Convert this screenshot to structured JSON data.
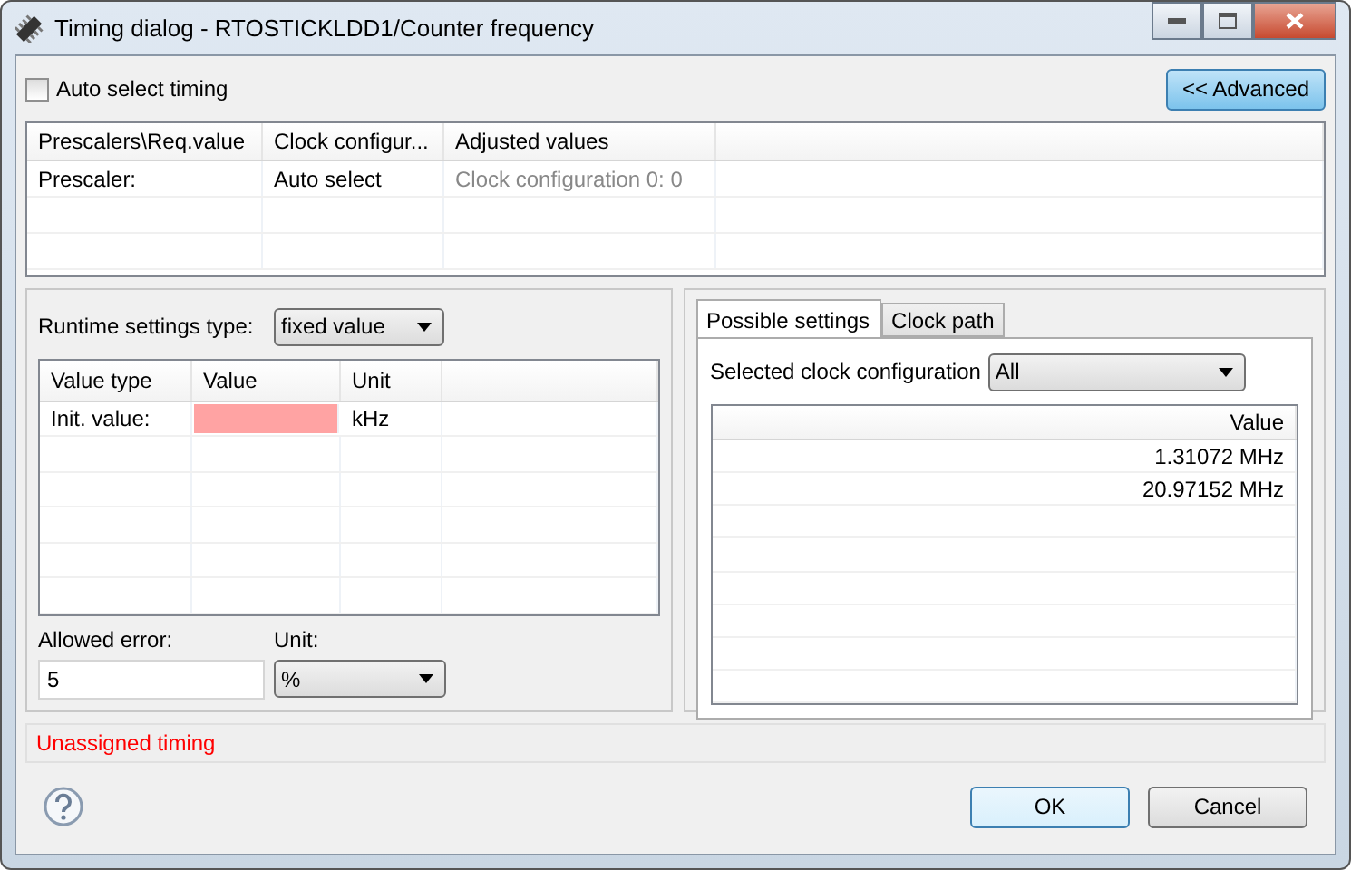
{
  "window": {
    "title": "Timing dialog - RTOSTICKLDD1/Counter frequency"
  },
  "auto_select": {
    "label": "Auto select timing",
    "checked": false
  },
  "advanced_button": {
    "label": "<< Advanced"
  },
  "prescaler_table": {
    "columns": [
      "Prescalers\\Req.value",
      "Clock configur...",
      "Adjusted values"
    ],
    "rows": [
      [
        "Prescaler:",
        "Auto select",
        "Clock configuration 0: 0"
      ]
    ]
  },
  "runtime": {
    "label": "Runtime settings type:",
    "value": "fixed value"
  },
  "value_table": {
    "columns": [
      "Value type",
      "Value",
      "Unit"
    ],
    "rows": [
      {
        "type": "Init. value:",
        "value": "",
        "invalid": true,
        "unit": "kHz"
      }
    ]
  },
  "allowed_error": {
    "label": "Allowed error:",
    "value": "5"
  },
  "unit": {
    "label": "Unit:",
    "value": "%"
  },
  "tabs": [
    {
      "label": "Possible settings",
      "selected": true
    },
    {
      "label": "Clock path",
      "selected": false
    }
  ],
  "clock_config": {
    "label": "Selected clock configuration",
    "value": "All"
  },
  "possible_table": {
    "columns": [
      "Value"
    ],
    "rows": [
      "1.31072 MHz",
      "20.97152 MHz"
    ]
  },
  "status": {
    "message": "Unassigned timing"
  },
  "buttons": [
    {
      "label": "OK",
      "default": true
    },
    {
      "label": "Cancel",
      "default": false
    }
  ]
}
